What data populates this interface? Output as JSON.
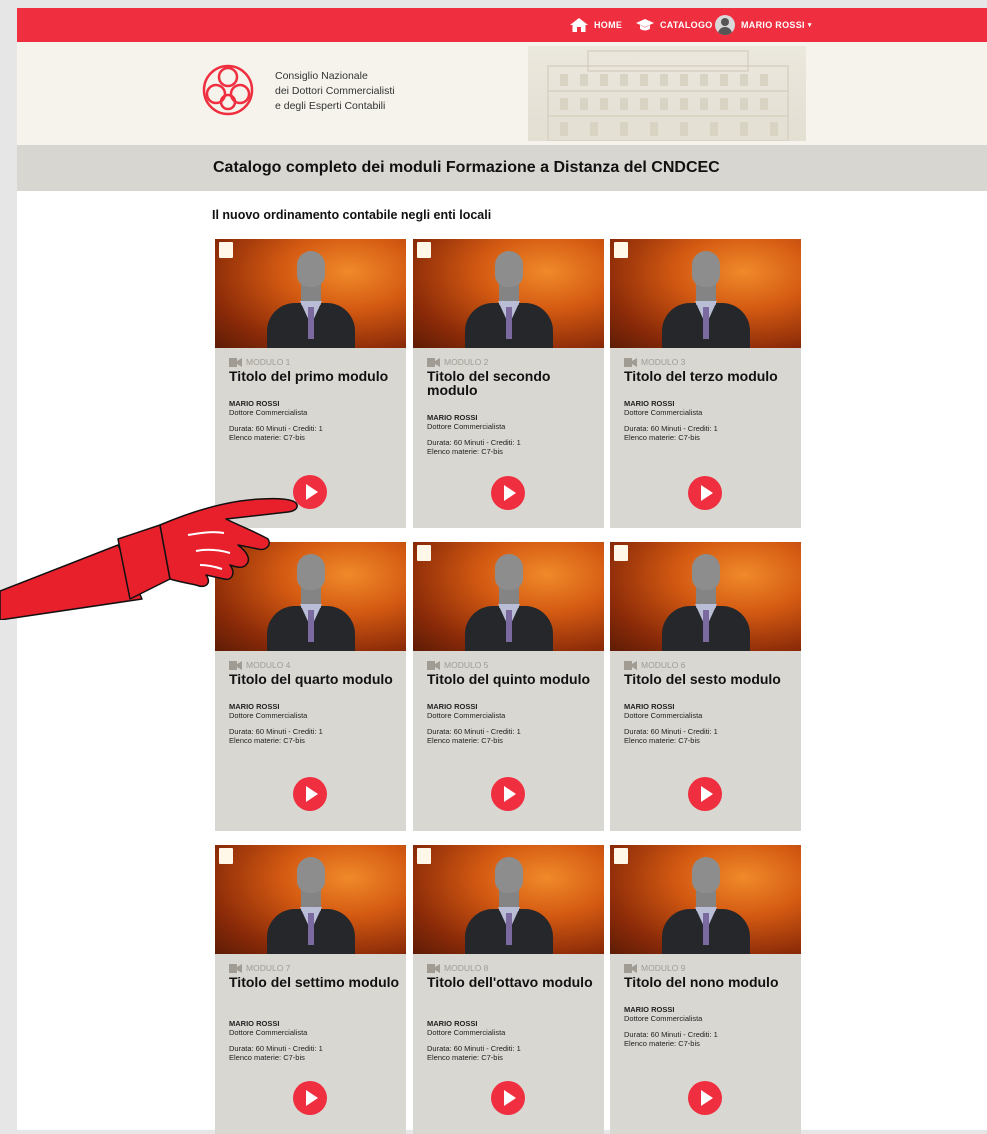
{
  "nav": {
    "home": "HOME",
    "catalog": "CATALOGO",
    "user": "MARIO ROSSI"
  },
  "org": {
    "line1": "Consiglio Nazionale",
    "line2": "dei Dottori Commercialisti",
    "line3": "e degli Esperti Contabili"
  },
  "page_title": "Catalogo completo dei moduli Formazione a Distanza del CNDCEC",
  "section_title": "Il nuovo ordinamento contabile negli enti locali",
  "cards": [
    {
      "module": "MODULO 1",
      "title": "Titolo del primo modulo",
      "author": "MARIO ROSSI",
      "role": "Dottore Commercialista",
      "duration": "Durata: 60 Minuti - Crediti: 1",
      "subjects": "Elenco materie: C7-bis"
    },
    {
      "module": "MODULO 2",
      "title": "Titolo del secondo modulo",
      "author": "MARIO ROSSI",
      "role": "Dottore Commercialista",
      "duration": "Durata: 60 Minuti - Crediti: 1",
      "subjects": "Elenco materie: C7-bis"
    },
    {
      "module": "MODULO 3",
      "title": "Titolo del terzo modulo",
      "author": "MARIO ROSSI",
      "role": "Dottore Commercialista",
      "duration": "Durata: 60 Minuti - Crediti: 1",
      "subjects": "Elenco materie: C7-bis"
    },
    {
      "module": "MODULO 4",
      "title": "Titolo del quarto modulo",
      "author": "MARIO ROSSI",
      "role": "Dottore Commercialista",
      "duration": "Durata: 60 Minuti - Crediti: 1",
      "subjects": "Elenco materie: C7-bis"
    },
    {
      "module": "MODULO 5",
      "title": "Titolo del quinto modulo",
      "author": "MARIO ROSSI",
      "role": "Dottore Commercialista",
      "duration": "Durata: 60 Minuti - Crediti: 1",
      "subjects": "Elenco materie: C7-bis"
    },
    {
      "module": "MODULO 6",
      "title": "Titolo del sesto modulo",
      "author": "MARIO ROSSI",
      "role": "Dottore Commercialista",
      "duration": "Durata: 60 Minuti - Crediti: 1",
      "subjects": "Elenco materie: C7-bis"
    },
    {
      "module": "MODULO 7",
      "title": "Titolo del settimo modulo",
      "author": "MARIO ROSSI",
      "role": "Dottore Commercialista",
      "duration": "Durata: 60 Minuti - Crediti: 1",
      "subjects": "Elenco materie: C7-bis"
    },
    {
      "module": "MODULO 8",
      "title": "Titolo dell'ottavo modulo",
      "author": "MARIO ROSSI",
      "role": "Dottore Commercialista",
      "duration": "Durata: 60 Minuti - Crediti: 1",
      "subjects": "Elenco materie: C7-bis"
    },
    {
      "module": "MODULO 9",
      "title": "Titolo del nono modulo",
      "author": "MARIO ROSSI",
      "role": "Dottore Commercialista",
      "duration": "Durata: 60 Minuti - Crediti: 1",
      "subjects": "Elenco materie: C7-bis"
    }
  ],
  "colors": {
    "brand_red": "#ef2e3f",
    "card_bg": "#d9d7d1",
    "header_bg": "#f5f3ec",
    "titlebar_bg": "#d8d6d1"
  },
  "icons": {
    "home": "home-icon",
    "catalog": "graduation-cap-icon",
    "module": "video-camera-icon",
    "play": "play-icon",
    "pointer": "pointing-hand-icon"
  }
}
